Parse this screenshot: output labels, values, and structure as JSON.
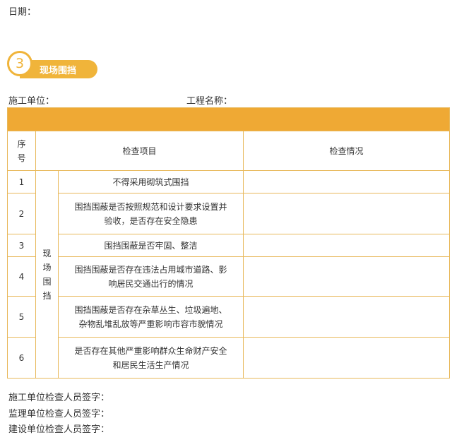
{
  "header": {
    "date_label": "日期："
  },
  "section": {
    "number": "3",
    "title": "现场围挡"
  },
  "meta": {
    "unit_label": "施工单位：",
    "project_label": "工程名称："
  },
  "table": {
    "headers": {
      "seq": "序\n号",
      "item": "检查项目",
      "status": "检查情况"
    },
    "category": "现\n场\n围\n挡",
    "rows": [
      {
        "no": "1",
        "text": "不得采用砌筑式围挡"
      },
      {
        "no": "2",
        "text": "围挡围蔽是否按照规范和设计要求设置并\n验收，是否存在安全隐患"
      },
      {
        "no": "3",
        "text": "围挡围蔽是否牢固、整洁"
      },
      {
        "no": "4",
        "text": "围挡围蔽是否存在违法占用城市道路、影\n响居民交通出行的情况"
      },
      {
        "no": "5",
        "text": "围挡围蔽是否存在杂草丛生、垃圾遍地、\n杂物乱堆乱放等严重影响市容市貌情况"
      },
      {
        "no": "6",
        "text": "是否存在其他严重影响群众生命财产安全\n和居民生活生产情况"
      }
    ]
  },
  "footer": {
    "builder_sign": "施工单位检查人员签字：",
    "supervisor_sign": "监理单位检查人员签字：",
    "owner_sign": "建设单位检查人员签字："
  },
  "colors": {
    "accent": "#f0b43a",
    "border": "#e8b85a"
  }
}
